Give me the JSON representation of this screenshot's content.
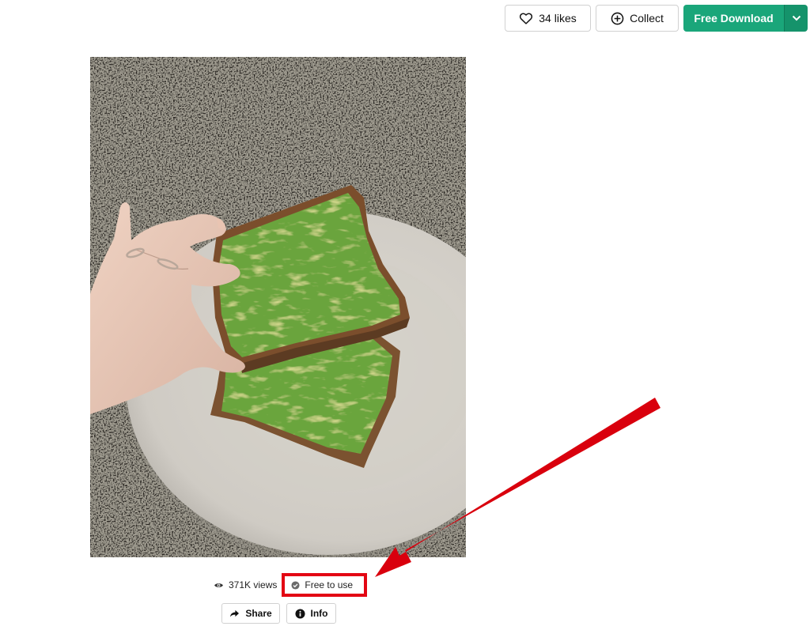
{
  "toolbar": {
    "likes_label": "34 likes",
    "collect_label": "Collect",
    "download_label": "Free Download",
    "icons": {
      "likes": "heart-icon",
      "collect": "plus-circle-icon",
      "download_menu": "chevron-down-icon"
    },
    "accent_color": "#1aa67a"
  },
  "photo": {
    "subject": "avocado toast"
  },
  "meta": {
    "views_label": "371K views",
    "license_label": "Free to use",
    "icons": {
      "views": "eye-icon",
      "license": "check-badge-icon"
    },
    "highlight_color": "#e30613"
  },
  "actions": {
    "share_label": "Share",
    "info_label": "Info",
    "icons": {
      "share": "share-arrow-icon",
      "info": "info-icon"
    }
  },
  "annotation": {
    "color": "#d9000d"
  }
}
